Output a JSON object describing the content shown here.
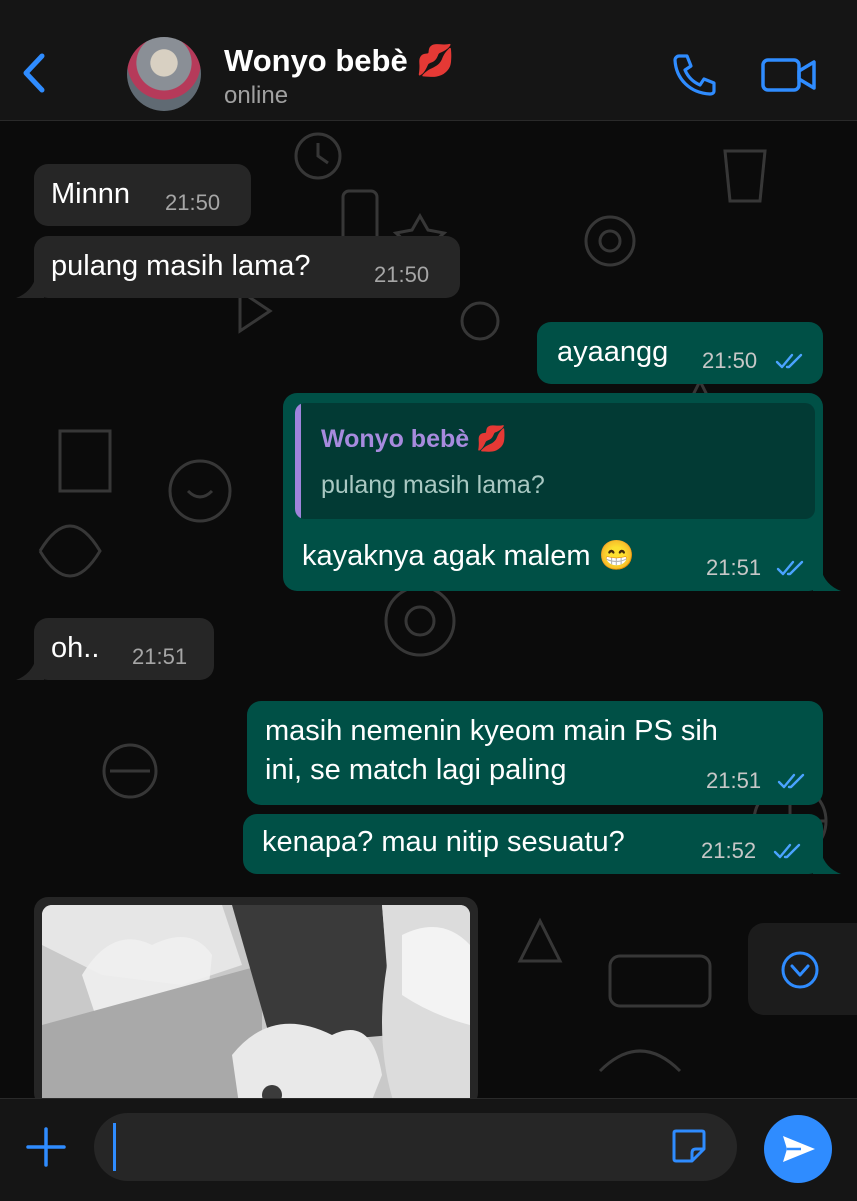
{
  "colors": {
    "accent": "#2f8cff",
    "outgoing_bubble": "#005046",
    "incoming_bubble": "#262626",
    "quote_author": "#a78bde"
  },
  "header": {
    "contact_name": "Wonyo bebè 💋",
    "status": "online",
    "icons": [
      "back-chevron-icon",
      "phone-icon",
      "video-camera-icon"
    ]
  },
  "messages": [
    {
      "direction": "in",
      "text": "Minnn",
      "time": "21:50"
    },
    {
      "direction": "in",
      "text": "pulang masih lama?",
      "time": "21:50"
    },
    {
      "direction": "out",
      "text": "ayaangg",
      "time": "21:50",
      "status": "read"
    },
    {
      "direction": "out",
      "reply_to": {
        "author": "Wonyo bebè 💋",
        "text": "pulang masih lama?"
      },
      "text": "kayaknya agak malem 😁",
      "time": "21:51",
      "status": "read"
    },
    {
      "direction": "in",
      "text": "oh..",
      "time": "21:51"
    },
    {
      "direction": "out",
      "lines": [
        "masih nemenin kyeom main PS sih",
        "ini, se match lagi paling"
      ],
      "time": "21:51",
      "status": "read"
    },
    {
      "direction": "out",
      "text": "kenapa? mau nitip sesuatu?",
      "time": "21:52",
      "status": "read"
    },
    {
      "direction": "in",
      "type": "photo"
    }
  ],
  "composer": {
    "value": "",
    "placeholder": "",
    "icons": [
      "plus-icon",
      "sticker-icon",
      "send-icon"
    ]
  }
}
